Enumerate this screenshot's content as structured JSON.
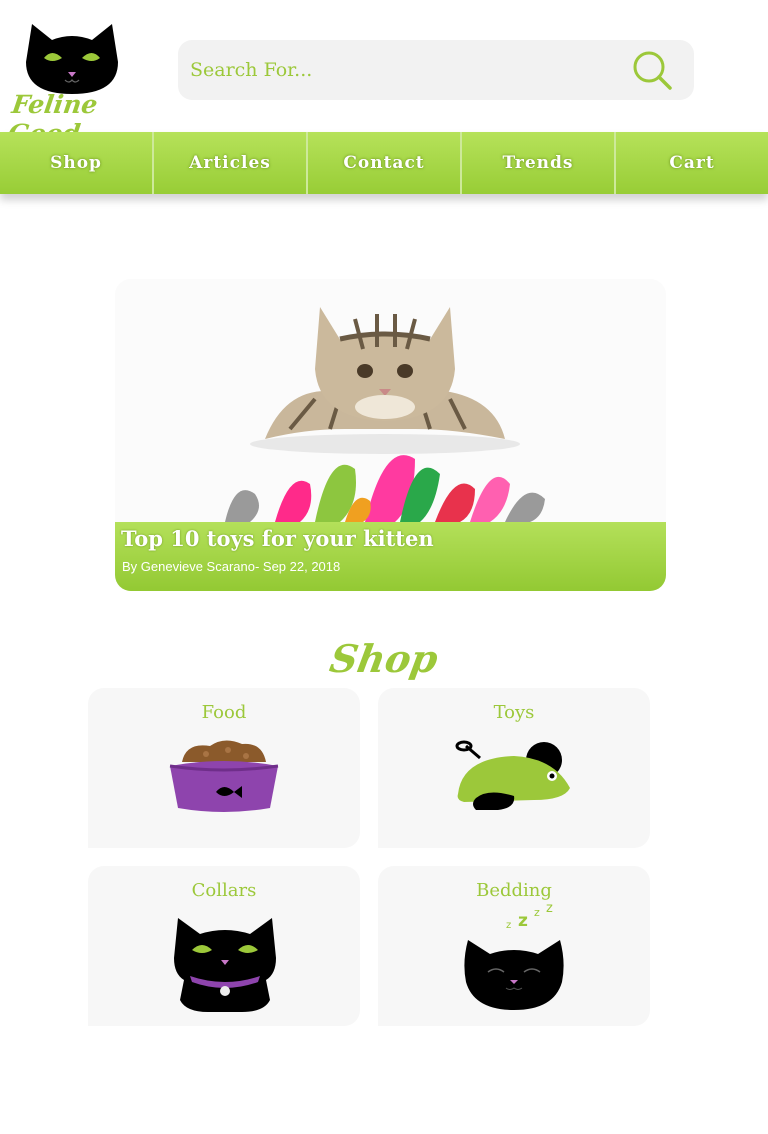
{
  "brand": {
    "name": "Feline Good"
  },
  "search": {
    "placeholder": "Search For..."
  },
  "nav": {
    "items": [
      "Shop",
      "Articles",
      "Contact",
      "Trends",
      "Cart"
    ]
  },
  "featured": {
    "title": "Top 10 toys for your kitten",
    "meta": "By Genevieve Scarano- Sep 22, 2018"
  },
  "shop": {
    "heading": "Shop",
    "categories": [
      "Food",
      "Toys",
      "Collars",
      "Bedding"
    ]
  },
  "colors": {
    "accent": "#9cc83a",
    "accent_dark": "#7ea82c",
    "purple": "#8e44ad",
    "black": "#000000"
  }
}
